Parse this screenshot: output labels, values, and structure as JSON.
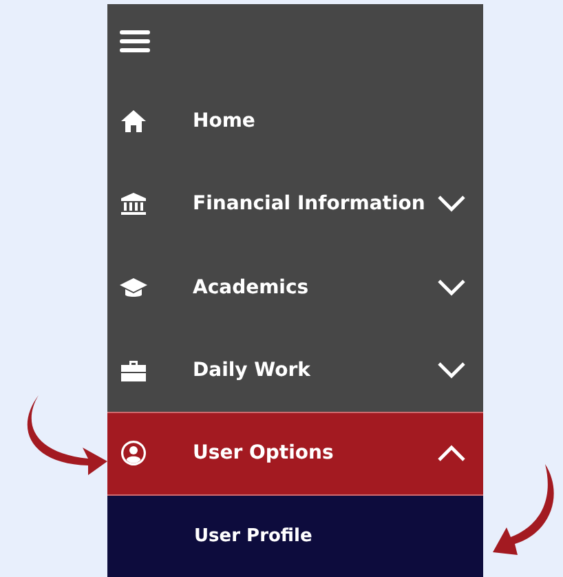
{
  "menu": {
    "items": [
      {
        "label": "Home",
        "selected": false
      },
      {
        "label": "Financial Information",
        "selected": false,
        "expanded": false
      },
      {
        "label": "Academics",
        "selected": false,
        "expanded": false
      },
      {
        "label": "Daily Work",
        "selected": false,
        "expanded": false
      },
      {
        "label": "User Options",
        "selected": true,
        "expanded": true,
        "children": [
          {
            "label": "User Profile"
          }
        ]
      }
    ]
  }
}
